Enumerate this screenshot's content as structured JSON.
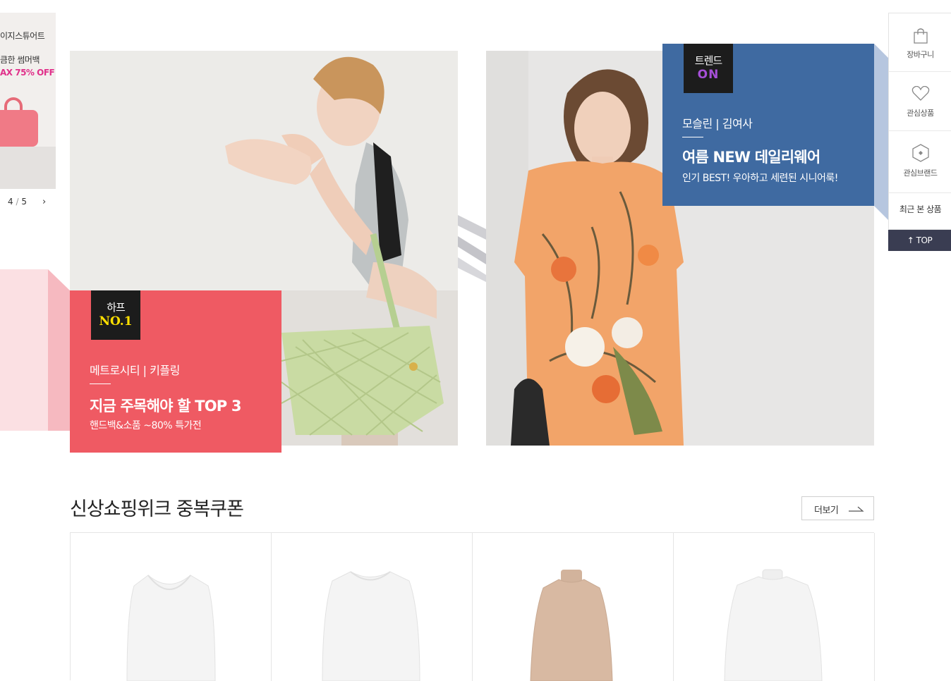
{
  "left_slide": {
    "line1": "이지스튜어트",
    "line2": "큼한 썸머백",
    "line3": "AX 75% OFF",
    "pager_current": "4",
    "pager_sep": "/",
    "pager_total": "5",
    "next_icon": "›"
  },
  "banner_left": {
    "badge_top": "하프",
    "badge_bottom": "NO.1",
    "brand": "메트로시티 | 키플링",
    "title": "지금 주목해야 할 TOP 3",
    "subtitle": "핸드백&소품 ~80% 특가전",
    "color": "#ef5a63"
  },
  "banner_right": {
    "badge_top": "트렌드",
    "badge_bottom": "ON",
    "brand": "모슬린 | 김여사",
    "title": "여름 NEW 데일리웨어",
    "subtitle": "인기 BEST! 우아하고 세련된 시니어룩!",
    "color": "#3f6aa1"
  },
  "sidebar": {
    "cart": "장바구니",
    "wishlist": "관심상품",
    "brands": "관심브랜드",
    "recent": "최근 본 상품",
    "top": "↑ TOP",
    "top_color": "#3a3d52"
  },
  "section": {
    "title": "신상쇼핑위크 중복쿠폰",
    "more": "더보기"
  },
  "products": [
    {
      "item": "white-scoop-neck-longsleeve",
      "color": "#f4f4f4"
    },
    {
      "item": "white-crew-neck-longsleeve",
      "color": "#f4f4f4"
    },
    {
      "item": "beige-turtleneck-longsleeve",
      "color": "#d8b9a2"
    },
    {
      "item": "white-mock-neck-longsleeve",
      "color": "#f4f4f4"
    }
  ]
}
